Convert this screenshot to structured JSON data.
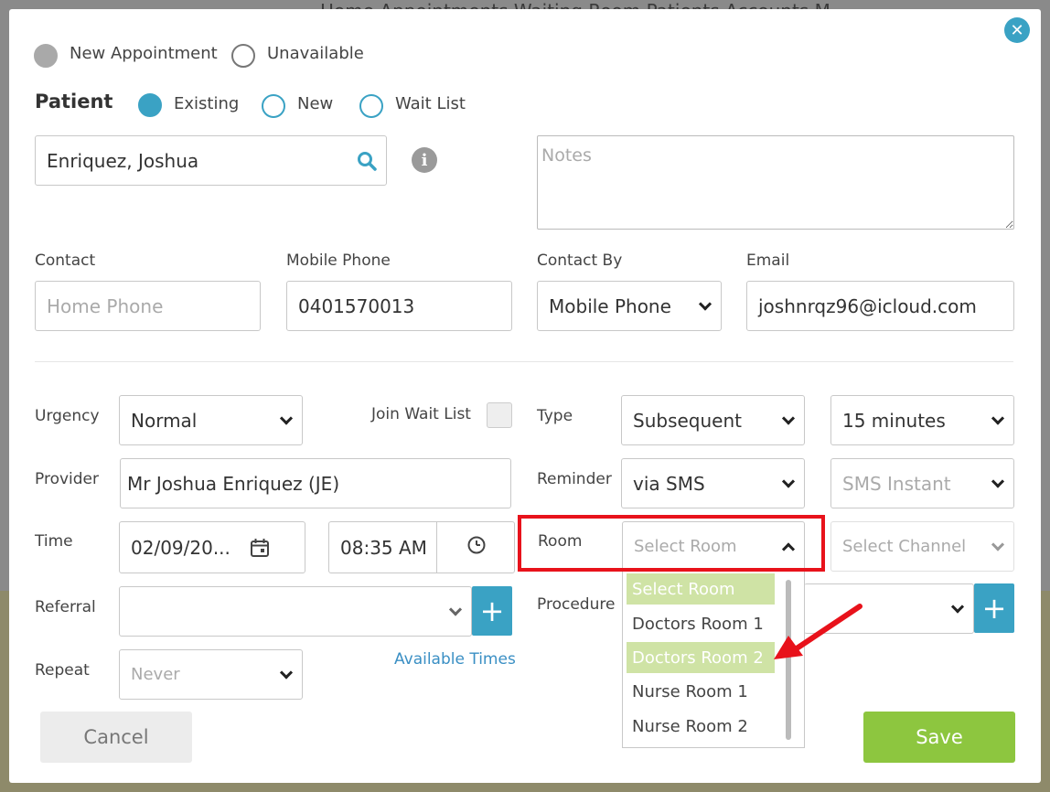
{
  "background": {
    "top_text": "Home   Appointments   Waiting Room   Patients   Accounts   M"
  },
  "appointment_type": {
    "options": [
      "New Appointment",
      "Unavailable"
    ]
  },
  "patient": {
    "heading": "Patient",
    "options": [
      "Existing",
      "New",
      "Wait List"
    ],
    "search_value": "Enriquez, Joshua",
    "notes_placeholder": "Notes"
  },
  "contact": {
    "contact_label": "Contact",
    "home_phone_placeholder": "Home Phone",
    "mobile_label": "Mobile Phone",
    "mobile_value": "0401570013",
    "contact_by_label": "Contact By",
    "contact_by_value": "Mobile Phone",
    "email_label": "Email",
    "email_value": "joshnrqz96@icloud.com"
  },
  "form": {
    "urgency_label": "Urgency",
    "urgency_value": "Normal",
    "join_wait_list_label": "Join Wait List",
    "type_label": "Type",
    "type_value": "Subsequent",
    "duration_value": "15 minutes",
    "provider_label": "Provider",
    "provider_value": "Mr Joshua Enriquez (JE)",
    "reminder_label": "Reminder",
    "reminder_value": "via SMS",
    "reminder_timing_placeholder": "SMS Instant",
    "time_label": "Time",
    "date_value": "02/09/20...",
    "time_value": "08:35 AM",
    "room_label": "Room",
    "room_placeholder": "Select Room",
    "channel_placeholder": "Select Channel",
    "referral_label": "Referral",
    "procedure_label": "Procedure",
    "repeat_label": "Repeat",
    "repeat_placeholder": "Never",
    "available_times_link": "Available Times"
  },
  "room_dropdown": {
    "options": [
      "Select Room",
      "Doctors Room 1",
      "Doctors Room 2",
      "Nurse Room 1",
      "Nurse Room 2"
    ]
  },
  "buttons": {
    "cancel": "Cancel",
    "save": "Save"
  },
  "colors": {
    "accent": "#3aa2c4",
    "save": "#8dc63f",
    "highlight": "#cfe3a5",
    "annotation": "#e8121b"
  }
}
